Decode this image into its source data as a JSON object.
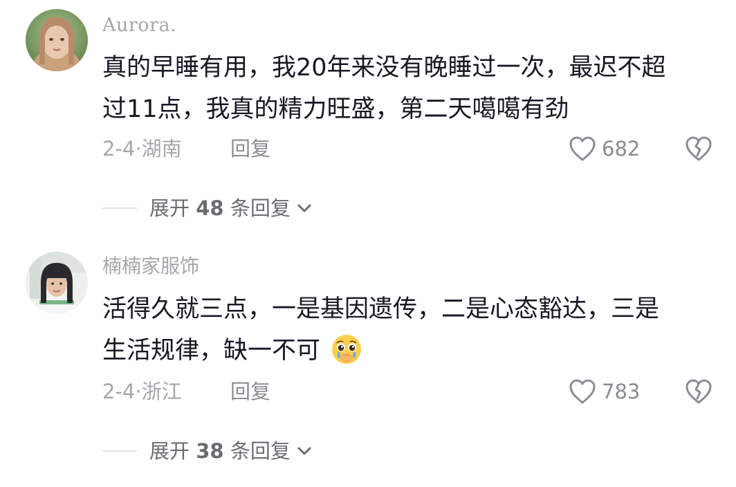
{
  "comments": [
    {
      "username": "Aurora.",
      "text_line1": "真的早睡有用，我20年来没有晚睡过一次，最迟不超",
      "text_line2": "过11点，我真的精力旺盛，第二天噶噶有劲",
      "meta": "2-4·湖南",
      "reply_label": "回复",
      "likes": "682",
      "expand_prefix": "展开",
      "expand_count": "48",
      "expand_suffix": "条回复"
    },
    {
      "username": "楠楠家服饰",
      "text_line1": "活得久就三点，一是基因遗传，二是心态豁达，三是",
      "text_line2": "生活规律，缺一不可",
      "meta": "2-4·浙江",
      "reply_label": "回复",
      "likes": "783",
      "expand_prefix": "展开",
      "expand_count": "38",
      "expand_suffix": "条回复"
    }
  ],
  "icons": {
    "like": "heart-outline-icon",
    "dislike": "broken-heart-icon",
    "expand": "chevron-down-icon",
    "emoji": "pleading-face-emoji"
  },
  "colors": {
    "text": "#161823",
    "secondary": "#a6a6ab",
    "action": "#8a8b91"
  }
}
